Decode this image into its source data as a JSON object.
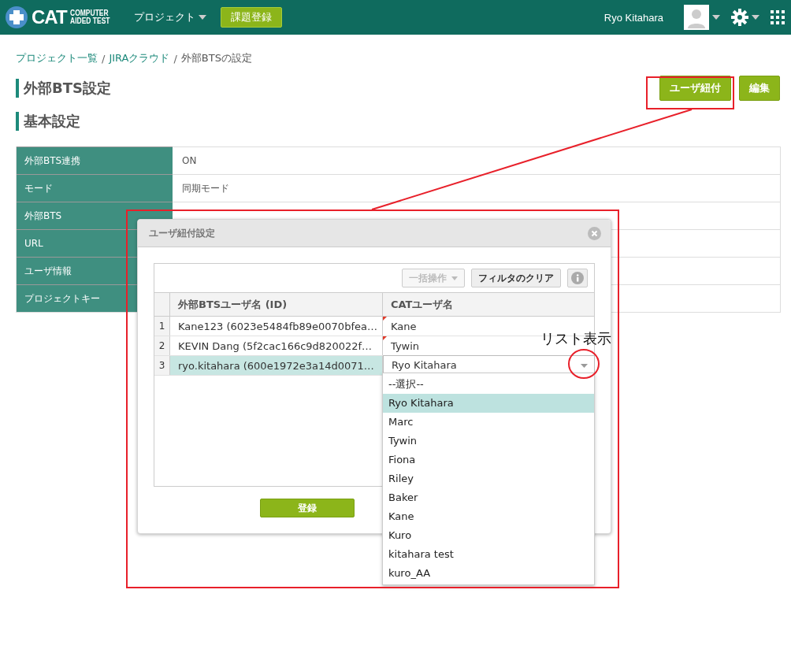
{
  "header": {
    "logo": {
      "mark": "CAT",
      "line1": "COMPUTER",
      "line2": "AIDED TEST"
    },
    "nav": "プロジェクト",
    "new_issue_button": "課題登録",
    "user": "Ryo Kitahara"
  },
  "breadcrumb": {
    "separator": "/",
    "items": [
      "プロジェクト一覧",
      "JIRAクラウド",
      "外部BTSの設定"
    ]
  },
  "page_title": "外部BTS設定",
  "buttons": [
    "ユーザ紐付",
    "編集"
  ],
  "section_title": "基本設定",
  "settings": [
    {
      "label": "外部BTS連携",
      "value": "ON"
    },
    {
      "label": "モード",
      "value": "同期モード"
    },
    {
      "label": "外部BTS"
    },
    {
      "label": "URL"
    },
    {
      "label": "ユーザ情報"
    },
    {
      "label": "プロジェクトキー"
    }
  ],
  "dialog": {
    "title": "ユーザ紐付設定",
    "bulk_button": {
      "label": "一括操作",
      "disabled": true
    },
    "clear_filter_button": "フィルタのクリア",
    "columns": [
      "外部BTSユーザ名 (ID)",
      "CATユーザ名"
    ],
    "rows": [
      {
        "num": "1",
        "bts_user": "Kane123 (6023e5484fb89e0070bfea…",
        "cat_user": "Kane",
        "changed": true,
        "selected": false
      },
      {
        "num": "2",
        "bts_user": "KEVIN Dang (5f2cac166c9d820022f…",
        "cat_user": "Tywin",
        "changed": true,
        "selected": false
      },
      {
        "num": "3",
        "bts_user": "ryo.kitahara (600e1972e3a14d0071…",
        "cat_user": "Ryo Kitahara",
        "changed": false,
        "selected": true
      }
    ],
    "dropdown_options": [
      {
        "label": "--選択--",
        "selected": false
      },
      {
        "label": "Ryo Kitahara",
        "selected": true
      },
      {
        "label": "Marc",
        "selected": false
      },
      {
        "label": "Tywin",
        "selected": false
      },
      {
        "label": "Fiona",
        "selected": false
      },
      {
        "label": "Riley",
        "selected": false
      },
      {
        "label": "Baker",
        "selected": false
      },
      {
        "label": "Kane",
        "selected": false
      },
      {
        "label": "Kuro",
        "selected": false
      },
      {
        "label": "kitahara test",
        "selected": false
      },
      {
        "label": "kuro_AA",
        "selected": false
      }
    ],
    "submit_button": "登録"
  },
  "annotation": {
    "label": "リスト表示"
  }
}
